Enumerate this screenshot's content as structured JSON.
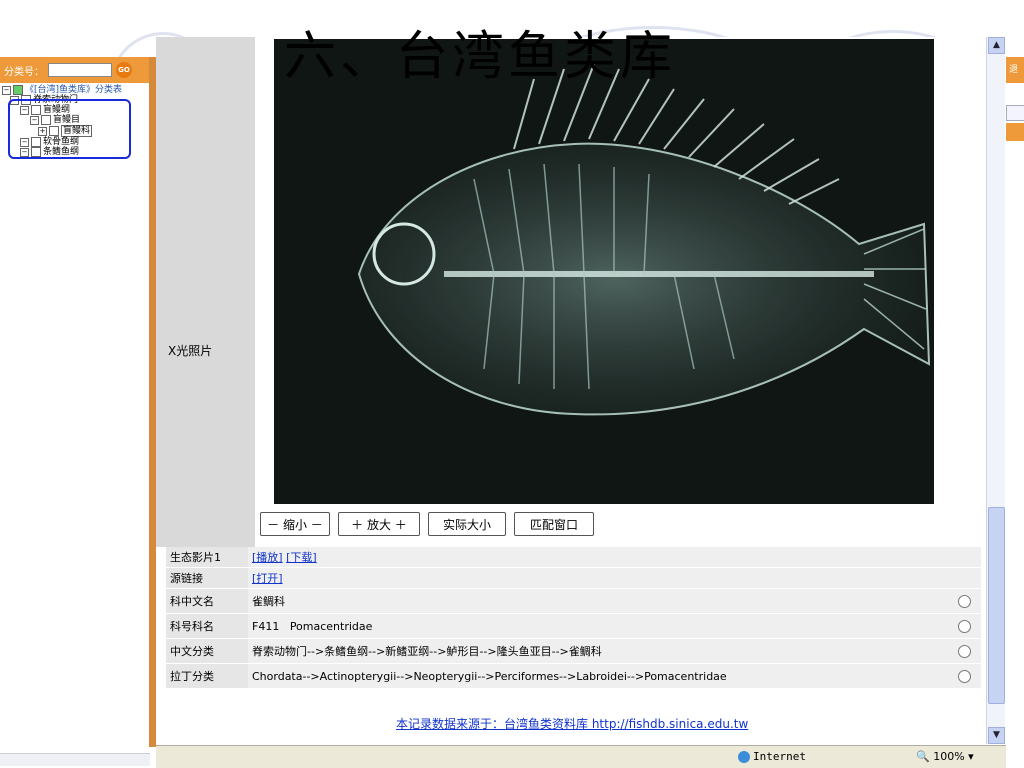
{
  "slide_title": "六、台湾鱼类库",
  "left_pane": {
    "search_label": "分类号：",
    "go_label": "GO",
    "tree": [
      {
        "label": "《[台湾]鱼类库》分类表",
        "level": 0,
        "root": true
      },
      {
        "label": "脊索动物门",
        "level": 1
      },
      {
        "label": "盲鳗纲",
        "level": 2
      },
      {
        "label": "盲鳗目",
        "level": 3
      },
      {
        "label": "盲鳗科",
        "level": 4
      },
      {
        "label": "软骨鱼纲",
        "level": 2
      },
      {
        "label": "条鳍鱼纲",
        "level": 2
      }
    ]
  },
  "main": {
    "xray_label": "X光照片",
    "controls": {
      "zoom_out": "－ 缩小 －",
      "zoom_in": "＋ 放大 ＋",
      "actual_size": "实际大小",
      "fit_window": "匹配窗口"
    },
    "rows": [
      {
        "key": "生态影片1",
        "links": [
          "[播放]",
          "[下载]"
        ]
      },
      {
        "key": "源链接",
        "links": [
          "[打开]"
        ]
      },
      {
        "key": "科中文名",
        "value": "雀鲷科",
        "radio": true
      },
      {
        "key": "科号科名",
        "value": "F411   Pomacentridae",
        "radio": true
      },
      {
        "key": "中文分类",
        "value": "脊索动物门-->条鳍鱼纲-->新鳍亚纲-->鲈形目-->隆头鱼亚目-->雀鲷科",
        "radio": true
      },
      {
        "key": "拉丁分类",
        "value": "Chordata-->Actinopterygii-->Neopterygii-->Perciformes-->Labroidei-->Pomacentridae",
        "radio": true
      }
    ],
    "source_text": "本记录数据来源于：台湾鱼类资料库  http://fishdb.sinica.edu.tw"
  },
  "status": {
    "zone": "Internet",
    "zoom": "100%"
  },
  "right_strip": {
    "label": "退出"
  },
  "colors": {
    "orange_bar": "#ee9a3a",
    "link": "#1133cc",
    "photo_bg": "#101613"
  }
}
